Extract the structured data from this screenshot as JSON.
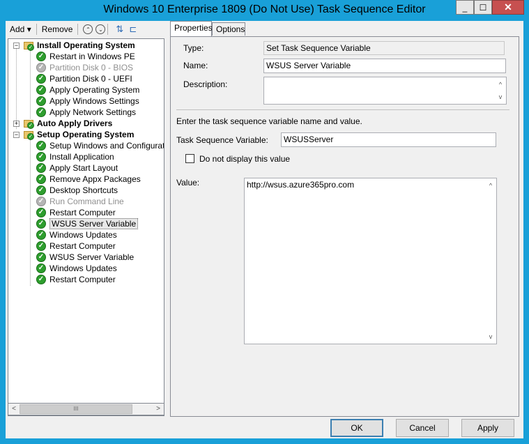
{
  "window": {
    "title": "Windows 10 Enterprise 1809 (Do Not Use) Task Sequence Editor",
    "close_glyph": "✕",
    "min_glyph": "_",
    "max_glyph": "☐"
  },
  "toolbar": {
    "add_label": "Add",
    "add_arrow": "▾",
    "remove_label": "Remove",
    "up_glyph": "⌃",
    "down_glyph": "⌄"
  },
  "tree": {
    "expand_minus": "−",
    "expand_plus": "+",
    "check_glyph": "✓",
    "items": [
      {
        "label": "Install Operating System"
      },
      {
        "label": "Restart in Windows PE"
      },
      {
        "label": "Partition Disk 0 - BIOS"
      },
      {
        "label": "Partition Disk 0 - UEFI"
      },
      {
        "label": "Apply Operating System"
      },
      {
        "label": "Apply Windows Settings"
      },
      {
        "label": "Apply Network Settings"
      },
      {
        "label": "Auto Apply Drivers"
      },
      {
        "label": "Setup Operating System"
      },
      {
        "label": "Setup Windows and Configuration"
      },
      {
        "label": "Install Application"
      },
      {
        "label": "Apply Start Layout"
      },
      {
        "label": "Remove Appx Packages"
      },
      {
        "label": "Desktop Shortcuts"
      },
      {
        "label": "Run Command Line"
      },
      {
        "label": "Restart Computer"
      },
      {
        "label": "WSUS Server Variable"
      },
      {
        "label": "Windows Updates"
      },
      {
        "label": "Restart Computer"
      },
      {
        "label": "WSUS Server Variable"
      },
      {
        "label": "Windows Updates"
      },
      {
        "label": "Restart Computer"
      }
    ],
    "hscroll": {
      "left": "<",
      "right": ">",
      "thumb": "III"
    }
  },
  "tabs": {
    "properties": "Properties",
    "options": "Options"
  },
  "properties": {
    "type_label": "Type:",
    "type_value": "Set Task Sequence Variable",
    "name_label": "Name:",
    "name_value": "WSUS Server Variable",
    "description_label": "Description:",
    "description_value": "",
    "instruction": "Enter the task sequence variable name and value.",
    "variable_label": "Task Sequence Variable:",
    "variable_value": "WSUSServer",
    "hide_value_label": "Do not display this value",
    "value_label": "Value:",
    "value_value": "http://wsus.azure365pro.com",
    "scroll_up": "^",
    "scroll_down": "v"
  },
  "buttons": {
    "ok": "OK",
    "cancel": "Cancel",
    "apply": "Apply"
  },
  "colors": {
    "titlebar": "#19a0d8",
    "close": "#c75050",
    "check_green": "#2e9e2e"
  }
}
